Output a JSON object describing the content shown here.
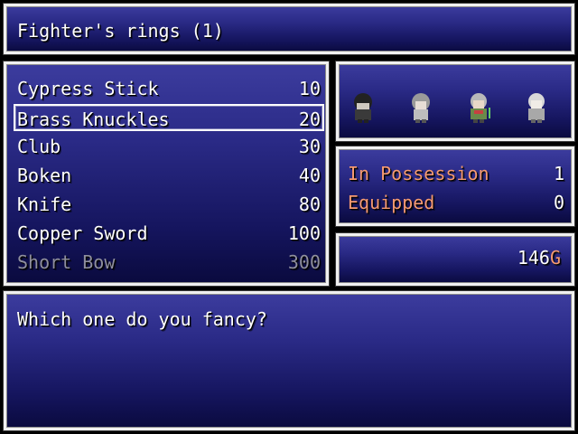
{
  "shop_title": "Fighter's rings (1)",
  "items": [
    {
      "name": "Cypress Stick",
      "price": "10",
      "selected": false,
      "enabled": true
    },
    {
      "name": "Brass Knuckles",
      "price": "20",
      "selected": true,
      "enabled": true
    },
    {
      "name": "Club",
      "price": "30",
      "selected": false,
      "enabled": true
    },
    {
      "name": "Boken",
      "price": "40",
      "selected": false,
      "enabled": true
    },
    {
      "name": "Knife",
      "price": "80",
      "selected": false,
      "enabled": true
    },
    {
      "name": "Copper Sword",
      "price": "100",
      "selected": false,
      "enabled": true
    },
    {
      "name": "Short Bow",
      "price": "300",
      "selected": false,
      "enabled": false
    }
  ],
  "party": [
    "dark-haired-hero-sprite-icon",
    "gray-haired-girl-sprite-icon",
    "green-clad-fighter-sprite-icon",
    "pale-elder-sprite-icon"
  ],
  "status": {
    "possession_label": "In Possession",
    "possession_value": "1",
    "equipped_label": "Equipped",
    "equipped_value": "0"
  },
  "gold": {
    "amount": "146",
    "unit": "G"
  },
  "message": "Which one do you fancy?",
  "colors": {
    "window_top": "#3c3c9e",
    "window_bottom": "#0a0a3e",
    "system_text": "#f59a72",
    "disabled_text": "#8f8f9f"
  }
}
